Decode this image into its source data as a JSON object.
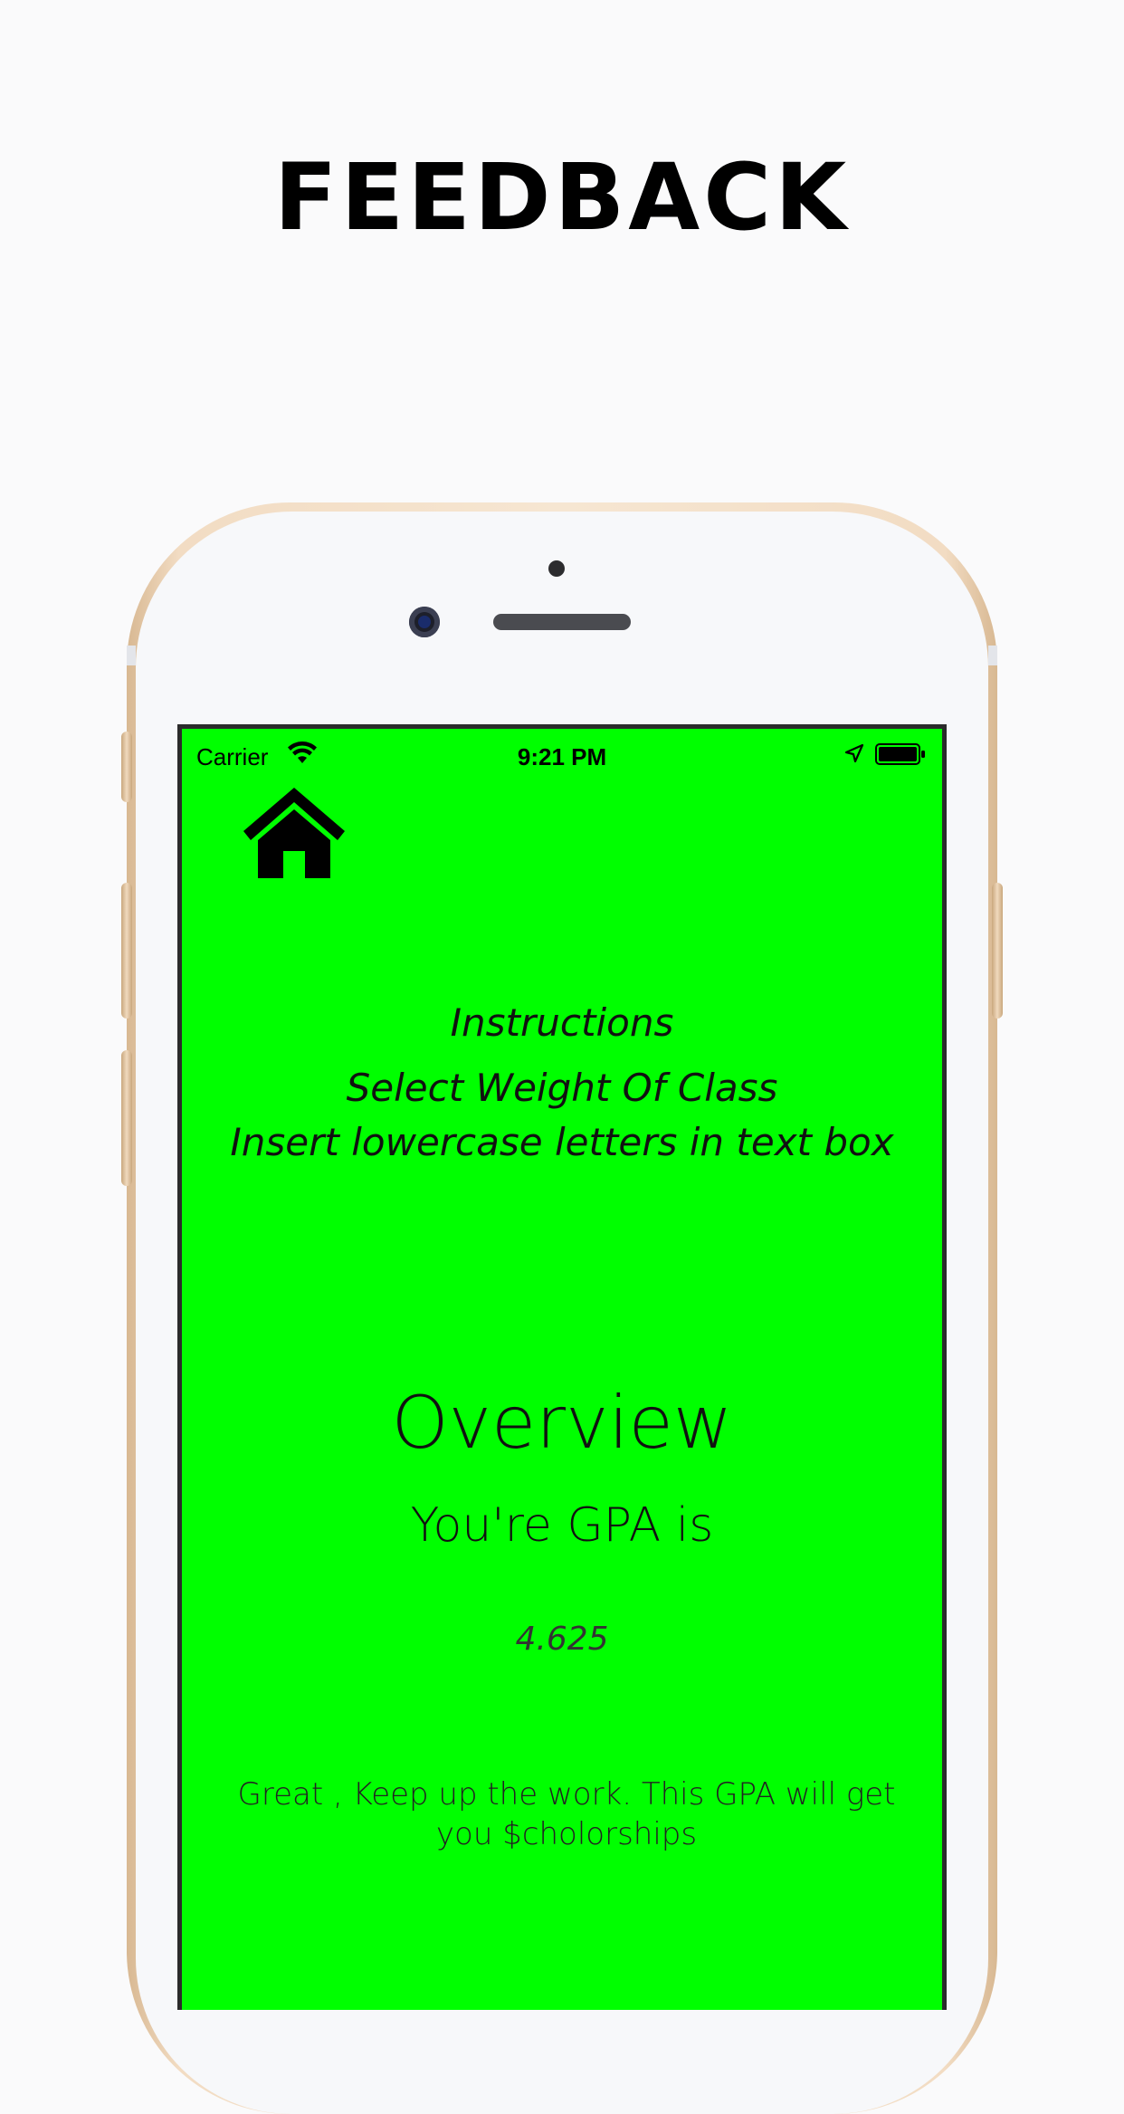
{
  "headline": "FEEDBACK",
  "status_bar": {
    "carrier": "Carrier",
    "time": "9:21 PM"
  },
  "instructions": {
    "title": "Instructions",
    "lines": [
      "Select Weight Of Class",
      "Insert lowercase letters in text box"
    ]
  },
  "overview": {
    "title": "Overview",
    "gpa_label": "You're GPA is",
    "gpa_value": "4.625",
    "message": "Great , Keep up the work. This GPA will get you $cholorships"
  },
  "colors": {
    "screen_background": "#00ff00",
    "page_background": "#fafafb",
    "phone_frame": "#f2dcc3"
  },
  "icons": [
    "home-icon",
    "wifi-icon",
    "location-arrow-icon",
    "battery-icon"
  ]
}
